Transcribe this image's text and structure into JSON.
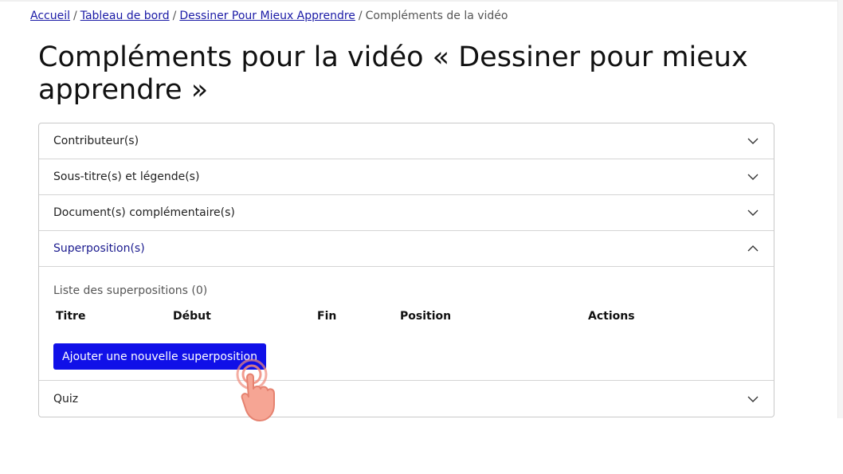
{
  "breadcrumb": {
    "items": [
      "Accueil",
      "Tableau de bord",
      "Dessiner Pour Mieux Apprendre"
    ],
    "current": "Compléments de la vidéo",
    "separator": "/"
  },
  "page": {
    "title": "Compléments pour la vidéo « Dessiner pour mieux apprendre »"
  },
  "accordion": {
    "sections": [
      {
        "label": "Contributeur(s)",
        "expanded": false
      },
      {
        "label": "Sous-titre(s) et légende(s)",
        "expanded": false
      },
      {
        "label": "Document(s) complémentaire(s)",
        "expanded": false
      },
      {
        "label": "Superposition(s)",
        "expanded": true
      },
      {
        "label": "Quiz",
        "expanded": false
      }
    ],
    "overlays": {
      "list_title": "Liste des superpositions (0)",
      "columns": [
        "Titre",
        "Début",
        "Fin",
        "Position",
        "Actions"
      ],
      "add_button": "Ajouter une nouvelle superposition"
    }
  },
  "colors": {
    "link": "#1a1aa6",
    "primary_button": "#1010e8",
    "expanded_header": "#1a1a8e"
  },
  "icons": {
    "collapsed": "chevron-down-icon",
    "expanded": "chevron-up-icon",
    "pointer": "hand-pointer-icon"
  }
}
